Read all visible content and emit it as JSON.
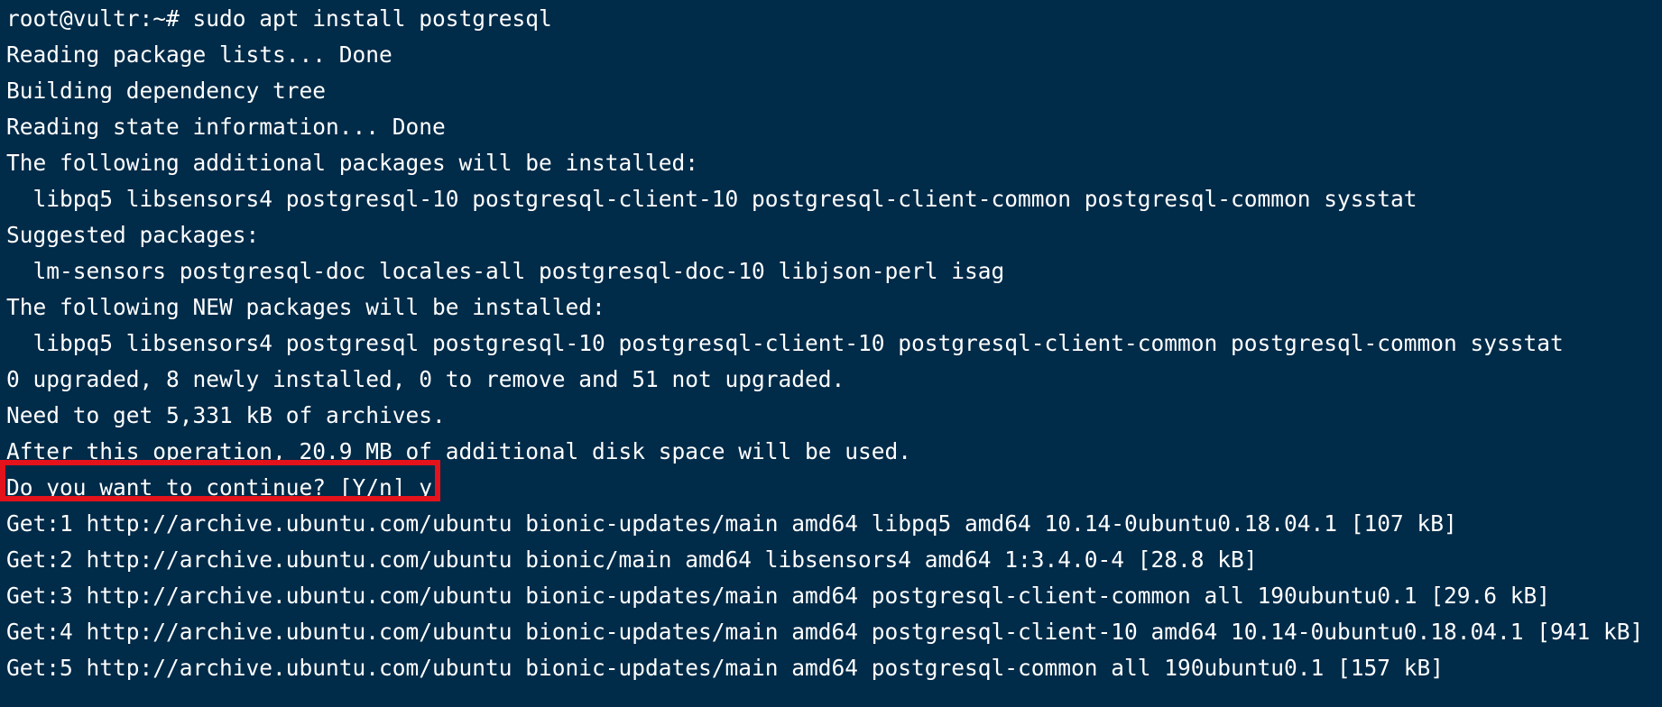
{
  "terminal": {
    "background": "#002b49",
    "text_color": "#ffffff",
    "highlight_color": "#e4131b",
    "lines": [
      "root@vultr:~# sudo apt install postgresql",
      "Reading package lists... Done",
      "Building dependency tree",
      "Reading state information... Done",
      "The following additional packages will be installed:",
      "  libpq5 libsensors4 postgresql-10 postgresql-client-10 postgresql-client-common postgresql-common sysstat",
      "Suggested packages:",
      "  lm-sensors postgresql-doc locales-all postgresql-doc-10 libjson-perl isag",
      "The following NEW packages will be installed:",
      "  libpq5 libsensors4 postgresql postgresql-10 postgresql-client-10 postgresql-client-common postgresql-common sysstat",
      "0 upgraded, 8 newly installed, 0 to remove and 51 not upgraded.",
      "Need to get 5,331 kB of archives.",
      "After this operation, 20.9 MB of additional disk space will be used.",
      "Do you want to continue? [Y/n] y",
      "Get:1 http://archive.ubuntu.com/ubuntu bionic-updates/main amd64 libpq5 amd64 10.14-0ubuntu0.18.04.1 [107 kB]",
      "Get:2 http://archive.ubuntu.com/ubuntu bionic/main amd64 libsensors4 amd64 1:3.4.0-4 [28.8 kB]",
      "Get:3 http://archive.ubuntu.com/ubuntu bionic-updates/main amd64 postgresql-client-common all 190ubuntu0.1 [29.6 kB]",
      "Get:4 http://archive.ubuntu.com/ubuntu bionic-updates/main amd64 postgresql-client-10 amd64 10.14-0ubuntu0.18.04.1 [941 kB]",
      "Get:5 http://archive.ubuntu.com/ubuntu bionic-updates/main amd64 postgresql-common all 190ubuntu0.1 [157 kB]"
    ]
  }
}
